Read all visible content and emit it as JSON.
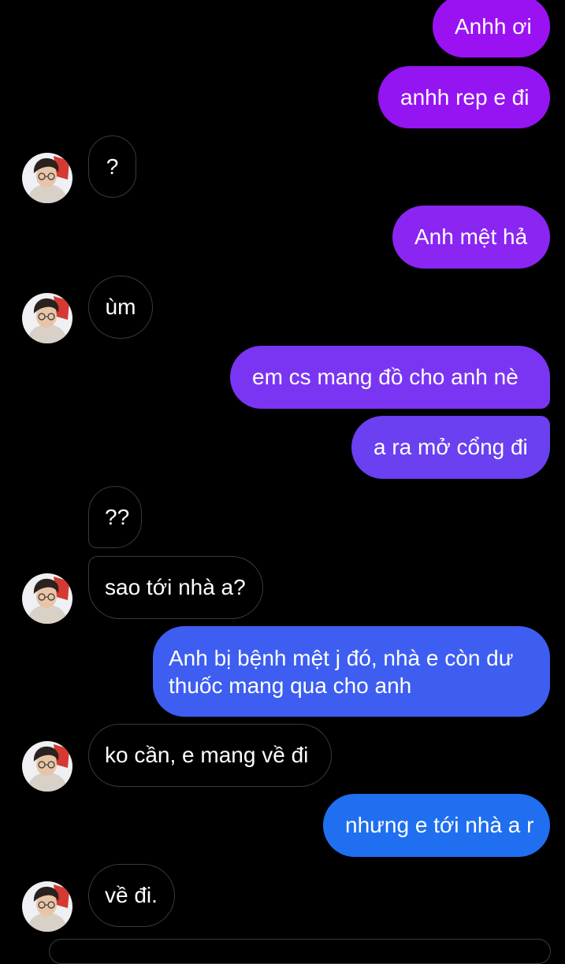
{
  "colors": {
    "background": "#000000",
    "incoming_border": "#3a3a3a",
    "gradient_top": "#9a12f2",
    "gradient_bottom": "#1e6ff0"
  },
  "messages": [
    {
      "id": "m1",
      "from": "me",
      "text": "Anhh ơi",
      "color": "#9a12f2"
    },
    {
      "id": "m2",
      "from": "me",
      "text": "anhh rep e đi",
      "color": "#9514f2"
    },
    {
      "id": "m3",
      "from": "them",
      "text": "?",
      "avatar": "avatar-icon"
    },
    {
      "id": "m4",
      "from": "me",
      "text": "Anh mệt hả",
      "color": "#8a25f2"
    },
    {
      "id": "m5",
      "from": "them",
      "text": "ùm",
      "avatar": "avatar-icon"
    },
    {
      "id": "m6",
      "from": "me",
      "text": "em cs mang đồ cho anh nè",
      "color": "#7a35f2"
    },
    {
      "id": "m7",
      "from": "me",
      "text": "a ra mở cổng đi",
      "color": "#6a40f1"
    },
    {
      "id": "m8",
      "from": "them",
      "text": "??"
    },
    {
      "id": "m9",
      "from": "them",
      "text": "sao tới nhà a?",
      "avatar": "avatar-icon"
    },
    {
      "id": "m10",
      "from": "me",
      "text": "Anh bị bệnh mệt j đó, nhà e còn dư thuốc mang qua cho anh",
      "color": "#3d5ef0"
    },
    {
      "id": "m11",
      "from": "them",
      "text": "ko cần, e mang về đi",
      "avatar": "avatar-icon"
    },
    {
      "id": "m12",
      "from": "me",
      "text": "nhưng e tới nhà a r",
      "color": "#1f6ff0"
    },
    {
      "id": "m13",
      "from": "them",
      "text": "về đi.",
      "avatar": "avatar-icon"
    }
  ]
}
